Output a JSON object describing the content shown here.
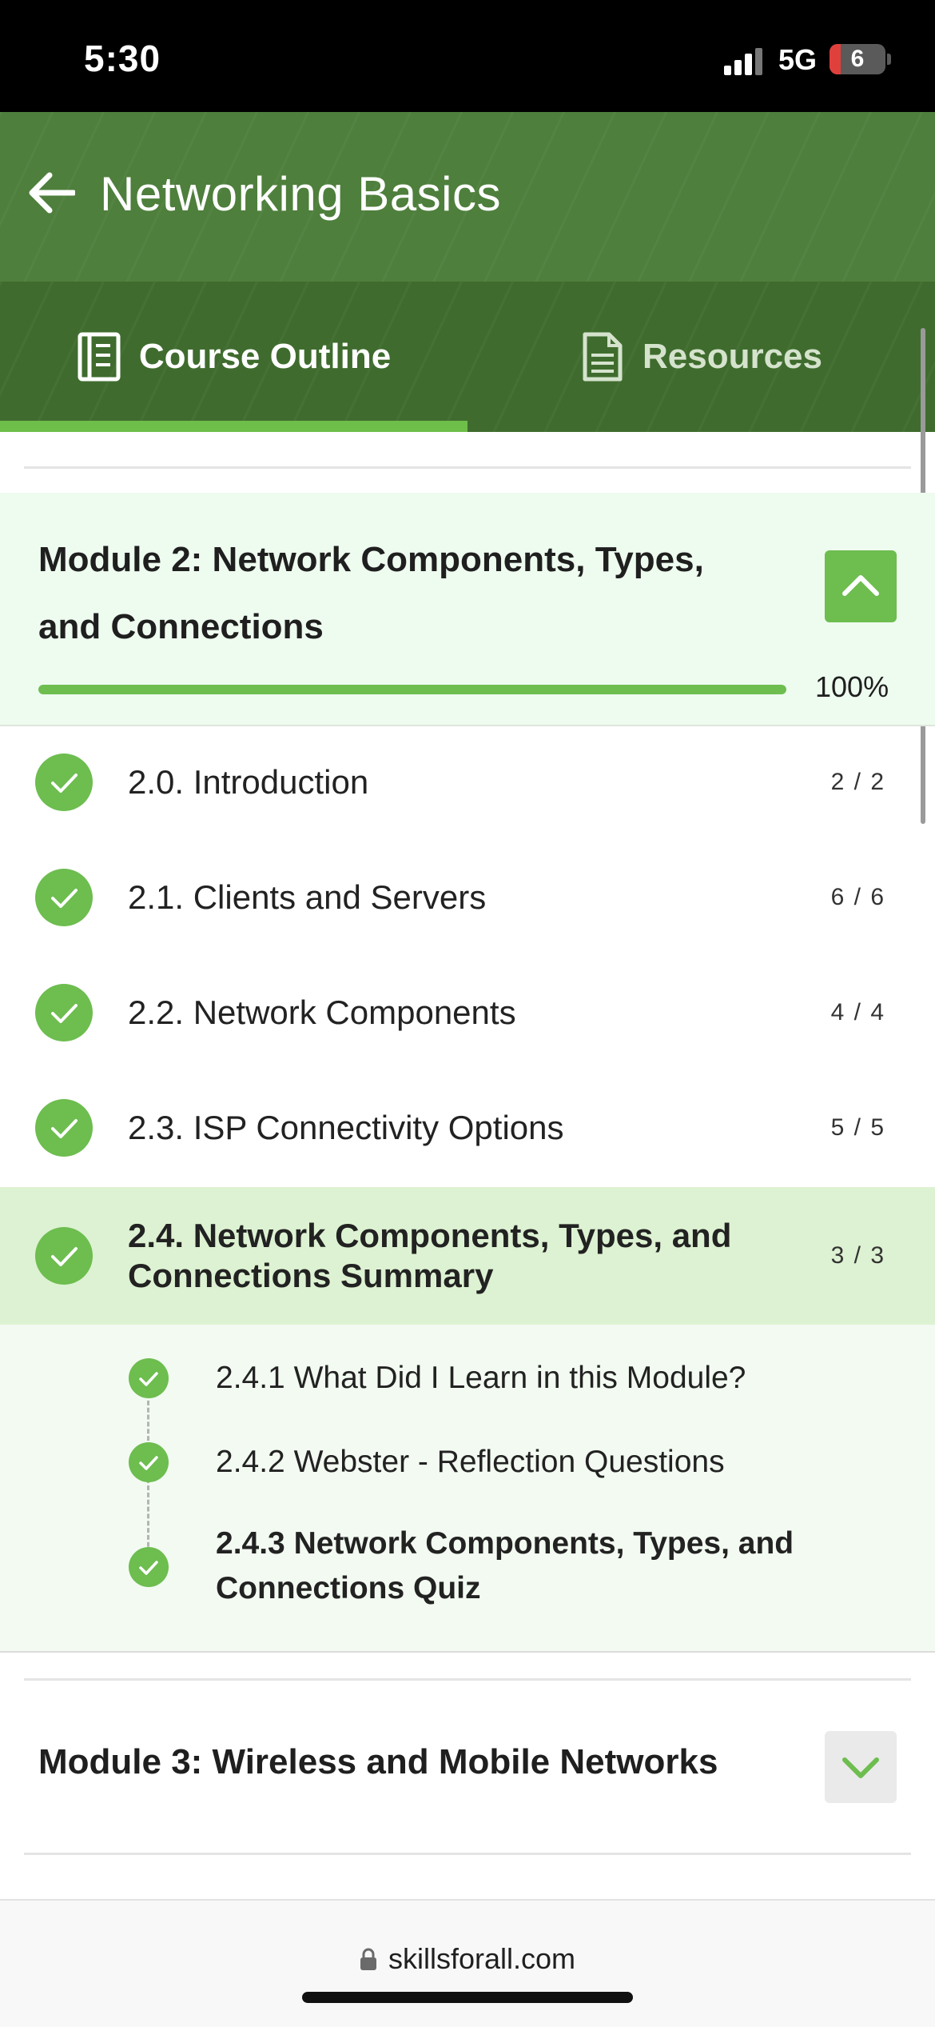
{
  "status_bar": {
    "time": "5:30",
    "network": "5G",
    "battery": "6",
    "battery_color": "#e0403c"
  },
  "header": {
    "title": "Networking Basics",
    "back_icon": "arrow-left-icon"
  },
  "tabs": [
    {
      "label": "Course Outline",
      "icon": "book-icon",
      "active": true
    },
    {
      "label": "Resources",
      "icon": "document-icon",
      "active": false
    }
  ],
  "module2": {
    "title": "Module 2: Network Components, Types, and Connections",
    "progress_text": "100%",
    "progress": 1.0,
    "expanded": true,
    "lessons": [
      {
        "label": "2.0. Introduction",
        "count": "2 / 2",
        "done": true
      },
      {
        "label": "2.1. Clients and Servers",
        "count": "6 / 6",
        "done": true
      },
      {
        "label": "2.2. Network Components",
        "count": "4 / 4",
        "done": true
      },
      {
        "label": "2.3. ISP Connectivity Options",
        "count": "5 / 5",
        "done": true
      },
      {
        "label": "2.4. Network Components, Types, and Connections Summary",
        "count": "3 / 3",
        "done": true,
        "active": true
      }
    ],
    "subitems": [
      {
        "label": "2.4.1 What Did I Learn in this Module?",
        "done": true
      },
      {
        "label": "2.4.2 Webster - Reflection Questions",
        "done": true
      },
      {
        "label": "2.4.3 Network Components, Types, and Connections Quiz",
        "done": true,
        "current": true
      }
    ]
  },
  "module3": {
    "title": "Module 3: Wireless and Mobile Networks",
    "expanded": false
  },
  "browser": {
    "url": "skillsforall.com"
  },
  "colors": {
    "brand_green": "#4e7f3c",
    "accent_green": "#6dbd4f",
    "active_row": "#ddf2d2"
  }
}
